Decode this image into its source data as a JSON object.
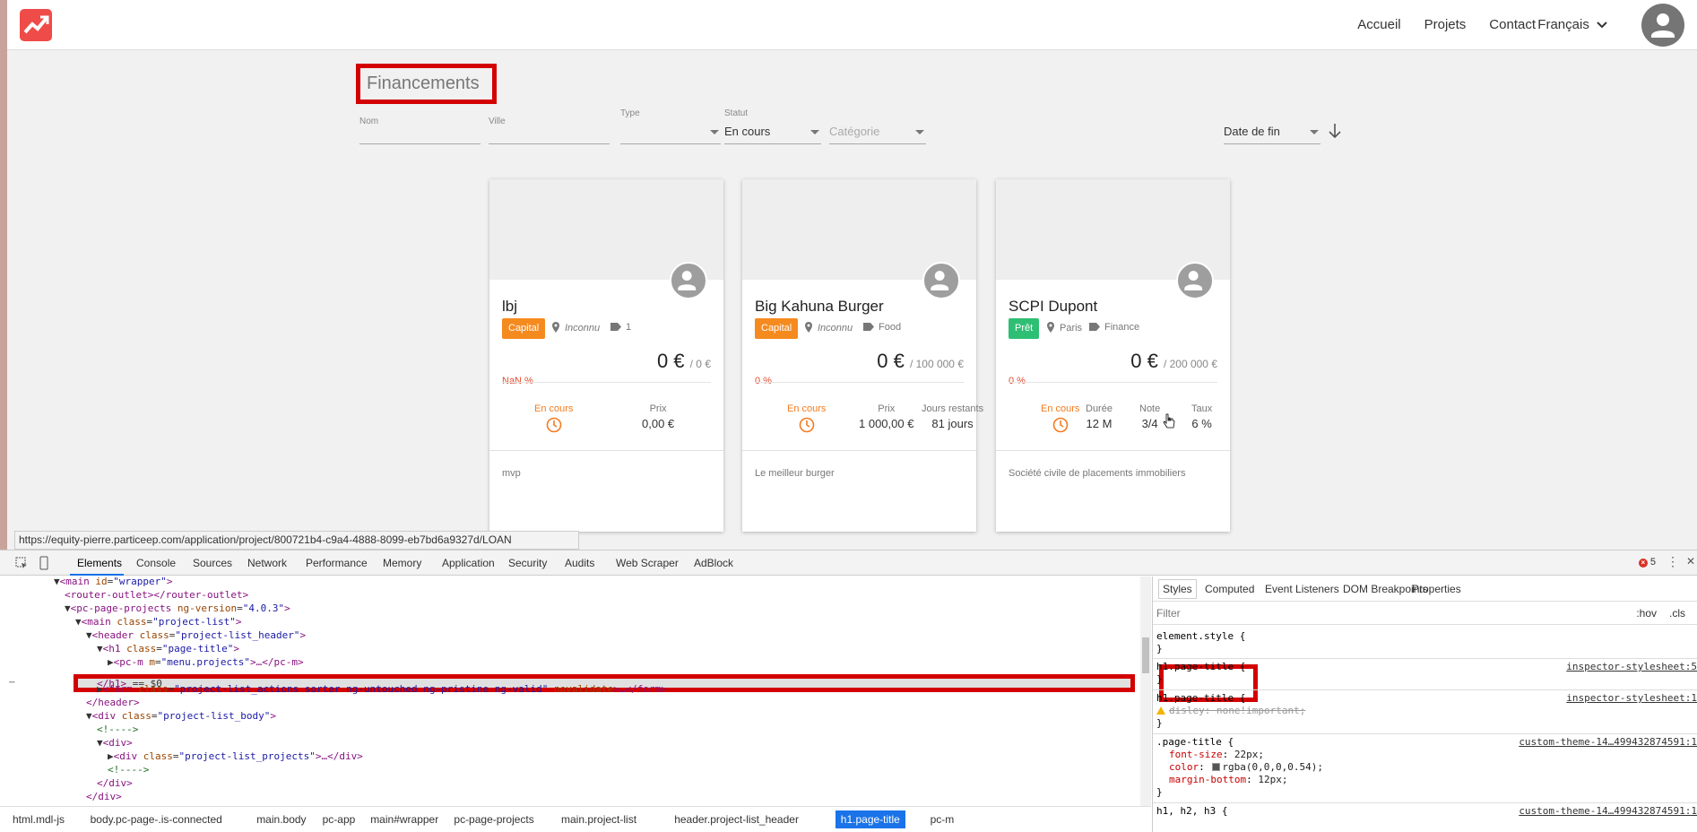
{
  "nav": {
    "links": [
      "Accueil",
      "Projets",
      "Contact"
    ],
    "language": "Français"
  },
  "page": {
    "title": "Financements"
  },
  "filters": {
    "nom_label": "Nom",
    "ville_label": "Ville",
    "type_label": "Type",
    "statut_label": "Statut",
    "statut_value": "En cours",
    "categorie_placeholder": "Catégorie",
    "sort_value": "Date de fin"
  },
  "cards": [
    {
      "name": "lbj",
      "badge": "Capital",
      "badge_color": "#f58a1f",
      "location": "Inconnu",
      "category": "1",
      "amount": "0 €",
      "goal": "/ 0 €",
      "percent": "NaN %",
      "status": "En cours",
      "stats": [
        {
          "label": "Prix",
          "value": "0,00 €"
        }
      ],
      "desc": "mvp"
    },
    {
      "name": "Big Kahuna Burger",
      "badge": "Capital",
      "badge_color": "#f58a1f",
      "location": "Inconnu",
      "category": "Food",
      "amount": "0 €",
      "goal": "/ 100 000 €",
      "percent": "0 %",
      "status": "En cours",
      "stats": [
        {
          "label": "Prix",
          "value": "1 000,00 €"
        },
        {
          "label": "Jours restants",
          "value": "81 jours"
        }
      ],
      "desc": "Le meilleur burger"
    },
    {
      "name": "SCPI Dupont",
      "badge": "Prêt",
      "badge_color": "#2ebf74",
      "location": "Paris",
      "category": "Finance",
      "amount": "0 €",
      "goal": "/ 200 000 €",
      "percent": "0 %",
      "status": "En cours",
      "stats": [
        {
          "label": "Durée",
          "value": "12 M"
        },
        {
          "label": "Note",
          "value": "3/4"
        },
        {
          "label": "Taux",
          "value": "6 %"
        }
      ],
      "desc": "Société civile de placements immobiliers"
    }
  ],
  "statusbar": {
    "url": "https://equity-pierre.particeep.com/application/project/800721b4-c9a4-4888-8099-eb7bd6a9327d/LOAN"
  },
  "devtools": {
    "tabs": [
      "Elements",
      "Console",
      "Sources",
      "Network",
      "Performance",
      "Memory",
      "Application",
      "Security",
      "Audits",
      "Web Scraper",
      "AdBlock"
    ],
    "error_count": "5",
    "dom_lines": [
      {
        "indent": 0,
        "arrow": "",
        "parts": [
          [
            "plain",
            "▼"
          ],
          [
            "tag",
            "<main"
          ],
          [
            "attr",
            " id"
          ],
          [
            "plain",
            "="
          ],
          [
            "aval",
            "\"wrapper\""
          ],
          [
            "tag",
            ">"
          ]
        ]
      },
      {
        "indent": 1,
        "arrow": "",
        "parts": [
          [
            "tag",
            "<router-outlet></router-outlet>"
          ]
        ]
      },
      {
        "indent": 1,
        "arrow": "",
        "parts": [
          [
            "plain",
            "▼"
          ],
          [
            "tag",
            "<pc-page-projects"
          ],
          [
            "attr",
            " ng-version"
          ],
          [
            "plain",
            "="
          ],
          [
            "aval",
            "\"4.0.3\""
          ],
          [
            "tag",
            ">"
          ]
        ]
      },
      {
        "indent": 2,
        "arrow": "",
        "parts": [
          [
            "plain",
            "▼"
          ],
          [
            "tag",
            "<main"
          ],
          [
            "attr",
            " class"
          ],
          [
            "plain",
            "="
          ],
          [
            "aval",
            "\"project-list\""
          ],
          [
            "tag",
            ">"
          ]
        ]
      },
      {
        "indent": 3,
        "arrow": "",
        "parts": [
          [
            "plain",
            "▼"
          ],
          [
            "tag",
            "<header"
          ],
          [
            "attr",
            " class"
          ],
          [
            "plain",
            "="
          ],
          [
            "aval",
            "\"project-list_header\""
          ],
          [
            "tag",
            ">"
          ]
        ]
      },
      {
        "indent": 4,
        "arrow": "",
        "parts": [
          [
            "plain",
            "▼"
          ],
          [
            "tag",
            "<h1"
          ],
          [
            "attr",
            " class"
          ],
          [
            "plain",
            "="
          ],
          [
            "aval",
            "\"page-title\""
          ],
          [
            "tag",
            ">"
          ]
        ]
      },
      {
        "indent": 5,
        "arrow": "",
        "parts": [
          [
            "plain",
            "▶"
          ],
          [
            "tag",
            "<pc-m"
          ],
          [
            "attr",
            " m"
          ],
          [
            "plain",
            "="
          ],
          [
            "aval",
            "\"menu.projects\""
          ],
          [
            "tag",
            ">…</pc-m>"
          ]
        ]
      },
      {
        "indent": 4,
        "arrow": "",
        "parts": [
          [
            "tag",
            "</h1>"
          ],
          [
            "plain",
            " == $0"
          ]
        ]
      },
      {
        "indent": 4,
        "arrow": "",
        "parts": [
          [
            "plain",
            "▶"
          ],
          [
            "tag",
            "<form"
          ],
          [
            "attr",
            " class"
          ],
          [
            "plain",
            "="
          ],
          [
            "aval",
            "\"project-list_actions sorter ng-untouched ng-pristine ng-valid\""
          ],
          [
            "attr",
            " novalidate"
          ],
          [
            "tag",
            ">…</form>"
          ]
        ]
      },
      {
        "indent": 3,
        "arrow": "",
        "parts": [
          [
            "tag",
            "</header>"
          ]
        ]
      },
      {
        "indent": 3,
        "arrow": "",
        "parts": [
          [
            "plain",
            "▼"
          ],
          [
            "tag",
            "<div"
          ],
          [
            "attr",
            " class"
          ],
          [
            "plain",
            "="
          ],
          [
            "aval",
            "\"project-list_body\""
          ],
          [
            "tag",
            ">"
          ]
        ]
      },
      {
        "indent": 4,
        "arrow": "",
        "parts": [
          [
            "cmt",
            "<!---->"
          ]
        ]
      },
      {
        "indent": 4,
        "arrow": "",
        "parts": [
          [
            "plain",
            "▼"
          ],
          [
            "tag",
            "<div>"
          ]
        ]
      },
      {
        "indent": 5,
        "arrow": "",
        "parts": [
          [
            "plain",
            "▶"
          ],
          [
            "tag",
            "<div"
          ],
          [
            "attr",
            " class"
          ],
          [
            "plain",
            "="
          ],
          [
            "aval",
            "\"project-list_projects\""
          ],
          [
            "tag",
            ">…</div>"
          ]
        ]
      },
      {
        "indent": 5,
        "arrow": "",
        "parts": [
          [
            "cmt",
            "<!---->"
          ]
        ]
      },
      {
        "indent": 4,
        "arrow": "",
        "parts": [
          [
            "tag",
            "</div>"
          ]
        ]
      },
      {
        "indent": 3,
        "arrow": "",
        "parts": [
          [
            "tag",
            "</div>"
          ]
        ]
      }
    ],
    "breadcrumbs": [
      "html.mdl-js",
      "body.pc-page-.is-connected",
      "main.body",
      "pc-app",
      "main#wrapper",
      "pc-page-projects",
      "main.project-list",
      "header.project-list_header",
      "h1.page-title",
      "pc-m"
    ],
    "active_breadcrumb": "h1.page-title",
    "styles_tabs": [
      "Styles",
      "Computed",
      "Event Listeners",
      "DOM Breakpoints",
      "Properties"
    ],
    "filter_placeholder": "Filter",
    "hov": ":hov",
    "cls": ".cls",
    "rules": {
      "element_style": "element.style {",
      "r1_sel": "h1.page-title {",
      "r1_src": "inspector-stylesheet:5",
      "r2_sel": "h1.page-title {",
      "r2_src": "inspector-stylesheet:1",
      "r2_prop": "disley: none!important;",
      "r3_sel": ".page-title {",
      "r3_src": "custom-theme-14…499432874591:1",
      "r3_props": [
        [
          "font-size",
          "22px;"
        ],
        [
          "color",
          "rgba(0,0,0,0.54);"
        ],
        [
          "margin-bottom",
          "12px;"
        ]
      ],
      "r4_sel": "h1, h2, h3 {",
      "r4_src": "custom-theme-14…499432874591:1"
    }
  }
}
